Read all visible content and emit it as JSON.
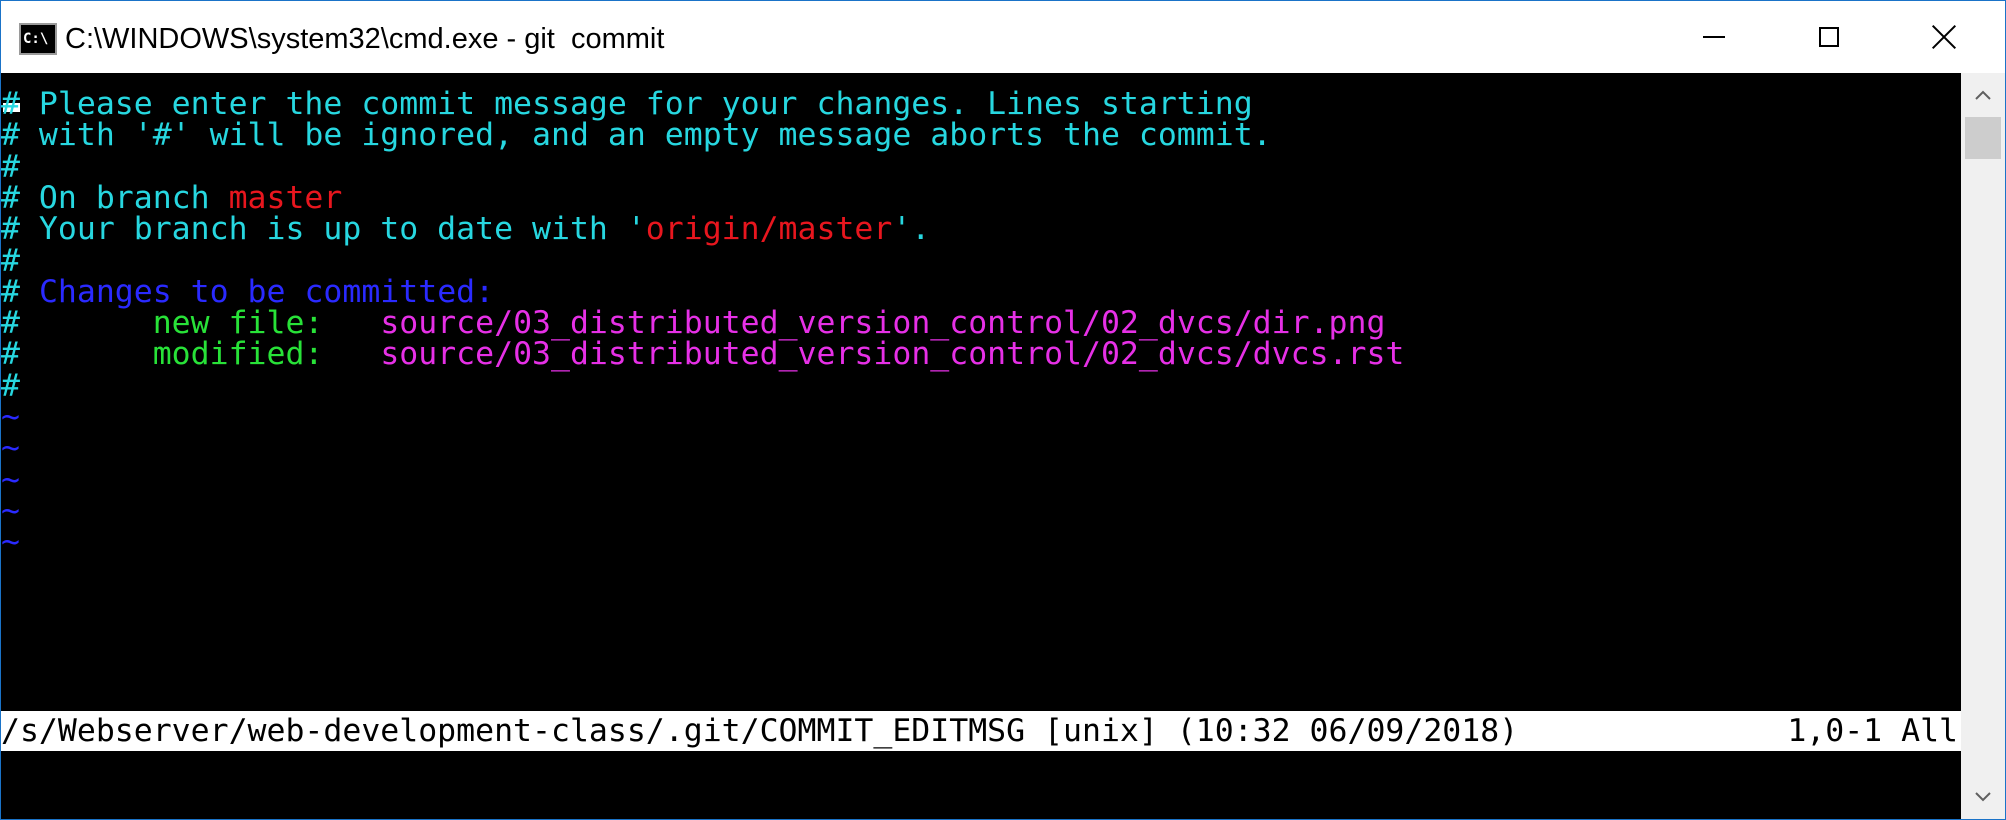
{
  "window": {
    "title": "C:\\WINDOWS\\system32\\cmd.exe - git  commit",
    "icon": "cmd-icon",
    "controls": [
      "minimize-icon",
      "maximize-icon",
      "close-icon"
    ]
  },
  "editor": {
    "lines": [
      {
        "segments": [
          {
            "text": "# Please enter the commit message for your changes. Lines starting",
            "color": "cyan"
          }
        ]
      },
      {
        "segments": [
          {
            "text": "# with '#' will be ignored, and an empty message aborts the commit.",
            "color": "cyan"
          }
        ]
      },
      {
        "segments": [
          {
            "text": "#",
            "color": "cyan"
          }
        ]
      },
      {
        "segments": [
          {
            "text": "# On branch ",
            "color": "cyan"
          },
          {
            "text": "master",
            "color": "red"
          }
        ]
      },
      {
        "segments": [
          {
            "text": "# Your branch is up to date with '",
            "color": "cyan"
          },
          {
            "text": "origin/master",
            "color": "red"
          },
          {
            "text": "'.",
            "color": "cyan"
          }
        ]
      },
      {
        "segments": [
          {
            "text": "#",
            "color": "cyan"
          }
        ]
      },
      {
        "segments": [
          {
            "text": "# ",
            "color": "cyan"
          },
          {
            "text": "Changes to be committed:",
            "color": "blue"
          }
        ]
      },
      {
        "segments": [
          {
            "text": "#       ",
            "color": "cyan"
          },
          {
            "text": "new file:",
            "color": "green"
          },
          {
            "text": "   ",
            "color": "cyan"
          },
          {
            "text": "source/03_distributed_version_control/02_dvcs/dir.png",
            "color": "magenta"
          }
        ]
      },
      {
        "segments": [
          {
            "text": "#       ",
            "color": "cyan"
          },
          {
            "text": "modified:",
            "color": "green"
          },
          {
            "text": "   ",
            "color": "cyan"
          },
          {
            "text": "source/03_distributed_version_control/02_dvcs/dvcs.rst",
            "color": "magenta"
          }
        ]
      },
      {
        "segments": [
          {
            "text": "#",
            "color": "cyan"
          }
        ]
      },
      {
        "segments": [
          {
            "text": "~",
            "color": "tilde"
          }
        ]
      },
      {
        "segments": [
          {
            "text": "~",
            "color": "tilde"
          }
        ]
      },
      {
        "segments": [
          {
            "text": "~",
            "color": "tilde"
          }
        ]
      },
      {
        "segments": [
          {
            "text": "~",
            "color": "tilde"
          }
        ]
      },
      {
        "segments": [
          {
            "text": "~",
            "color": "tilde"
          }
        ]
      }
    ],
    "status_file": "/s/Webserver/web-development-class/.git/COMMIT_EDITMSG [unix] (10:32 06/09/2018)",
    "status_pos": "1,0-1 All"
  },
  "colors": {
    "cyan": "#27d7e0",
    "red": "#e8161e",
    "blue": "#2a2aff",
    "green": "#28e238",
    "magenta": "#e630e6",
    "tilde": "#2a2aff",
    "background": "#000000"
  }
}
